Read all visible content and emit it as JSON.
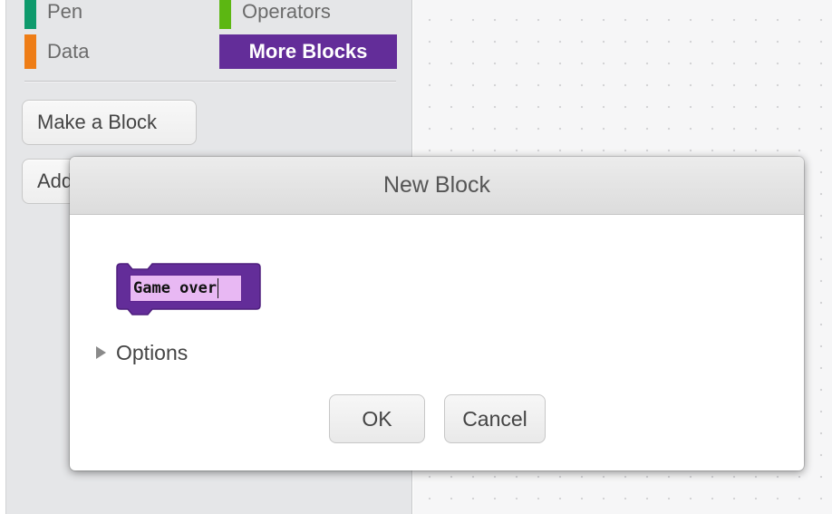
{
  "palette": {
    "categories": [
      {
        "label": "Pen",
        "color": "#0e9a6c"
      },
      {
        "label": "Operators",
        "color": "#5cb712"
      },
      {
        "label": "Data",
        "color": "#ee7d16"
      },
      {
        "label": "More Blocks",
        "color": "#632d99",
        "selected": true
      }
    ],
    "make_block_label": "Make a Block",
    "add_extension_label": "Add an Extension"
  },
  "dialog": {
    "title": "New Block",
    "block": {
      "color": "#632d99",
      "input_value": "Game over"
    },
    "options_label": "Options",
    "options_icon": "triangle-right-icon",
    "ok_label": "OK",
    "cancel_label": "Cancel"
  }
}
